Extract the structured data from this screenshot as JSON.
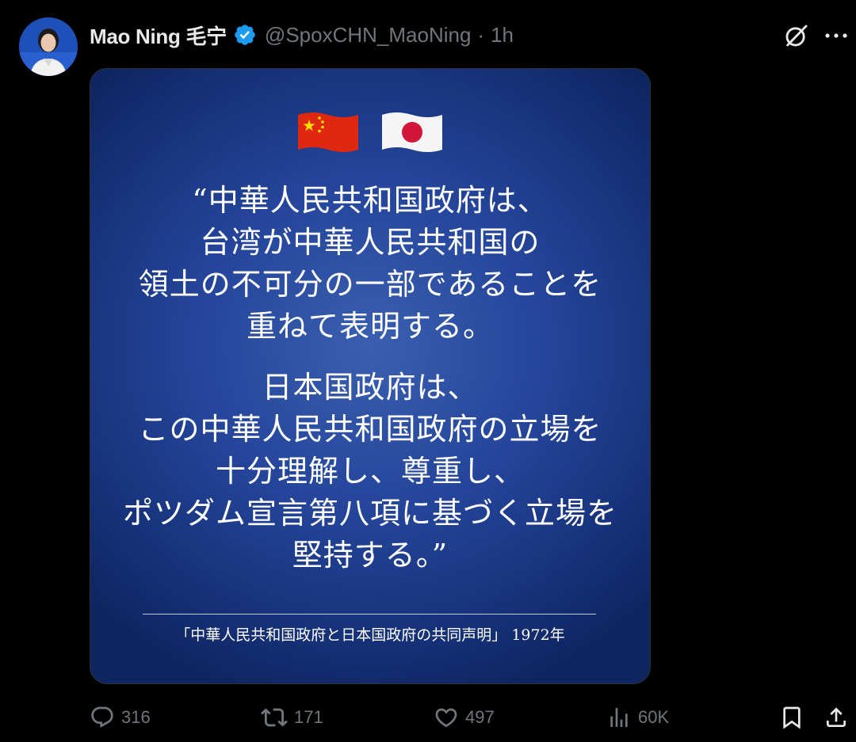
{
  "post": {
    "author": {
      "display_name": "Mao Ning 毛宁",
      "handle": "@SpoxCHN_MaoNing",
      "time_separator": "·",
      "time": "1h",
      "verified_icon": "verified-badge-icon",
      "verified_color": "#1d9bf0"
    },
    "image": {
      "flags": [
        "china-flag-icon",
        "japan-flag-icon"
      ],
      "quote_lines_1": [
        "“中華人民共和国政府は、",
        "台湾が中華人民共和国の",
        "領土の不可分の一部であることを",
        "重ねて表明する。"
      ],
      "quote_lines_2": [
        "日本国政府は、",
        "この中華人民共和国政府の立場を",
        "十分理解し、尊重し、",
        "ポツダム宣言第八項に基づく立場を",
        "堅持する。”"
      ],
      "source": "「中華人民共和国政府と日本国政府の共同声明」 1972年",
      "background_color": "#24459a"
    },
    "actions": {
      "replies": "316",
      "reposts": "171",
      "likes": "497",
      "views": "60K"
    },
    "text_secondary_color": "#71767b"
  }
}
